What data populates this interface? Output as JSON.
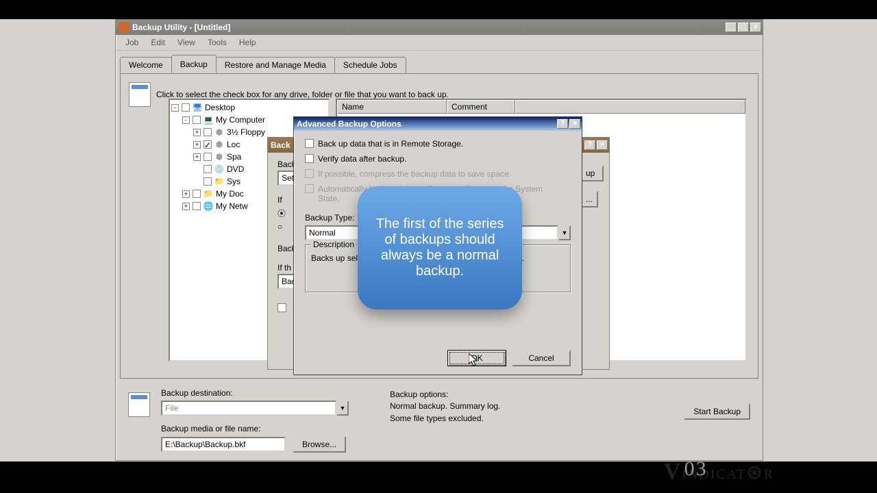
{
  "window": {
    "title": "Backup Utility - [Untitled]"
  },
  "menu": [
    "Job",
    "Edit",
    "View",
    "Tools",
    "Help"
  ],
  "tabs": {
    "items": [
      "Welcome",
      "Backup",
      "Restore and Manage Media",
      "Schedule Jobs"
    ],
    "active": 1
  },
  "instructions": "Click to select the check box for any drive, folder or file that you want to back up.",
  "tree": [
    {
      "depth": 0,
      "exp": "-",
      "chk": false,
      "icon": "desktop",
      "label": "Desktop"
    },
    {
      "depth": 1,
      "exp": "-",
      "chk": false,
      "icon": "pc",
      "label": "My Computer"
    },
    {
      "depth": 2,
      "exp": "+",
      "chk": false,
      "icon": "drive",
      "label": "3½ Floppy"
    },
    {
      "depth": 2,
      "exp": "+",
      "chk": true,
      "icon": "drive",
      "label": "Loc"
    },
    {
      "depth": 2,
      "exp": "+",
      "chk": false,
      "icon": "drive",
      "label": "Spa"
    },
    {
      "depth": 2,
      "exp": "",
      "chk": false,
      "icon": "cd",
      "label": "DVD"
    },
    {
      "depth": 2,
      "exp": "",
      "chk": false,
      "icon": "folder",
      "label": "Sys"
    },
    {
      "depth": 1,
      "exp": "+",
      "chk": false,
      "icon": "folder",
      "label": "My Doc"
    },
    {
      "depth": 1,
      "exp": "+",
      "chk": false,
      "icon": "net",
      "label": "My Netw"
    }
  ],
  "list": {
    "columns": [
      "Name",
      "Comment"
    ]
  },
  "bottom": {
    "dest_label": "Backup destination:",
    "dest_value": "File",
    "media_label": "Backup media or file name:",
    "media_value": "E:\\Backup\\Backup.bkf",
    "browse": "Browse...",
    "opts_label": "Backup options:",
    "opts_line1": "Normal backup.  Summary log.",
    "opts_line2": "Some file types excluded.",
    "start": "Start Backup"
  },
  "modal1": {
    "title": "Back",
    "desc_label": "Back",
    "set_value": "Set",
    "if_label": "If",
    "radio_a": "",
    "type_label": "Backup Type",
    "if2_label": "If th",
    "bad_value": "Bad",
    "last_chk": "",
    "start_backup": "up",
    "dots": "..."
  },
  "modal2": {
    "title": "Advanced Backup Options",
    "opt1": "Back up data that is in Remote Storage.",
    "opt2": "Verify data after backup.",
    "opt3": "If possible, compress the backup data to save space.",
    "opt4a": "Automatically backup System Protected Files with the System",
    "opt4b": "State.",
    "type_label": "Backup Type:",
    "type_value": "Normal",
    "desc_legend": "Description",
    "desc_text": "Backs up selected files, and marks each file as backed up.",
    "ok": "OK",
    "cancel": "Cancel"
  },
  "tooltip": "The first of the series of backups should always be a normal backup.",
  "watermark": "VINDICATOR"
}
